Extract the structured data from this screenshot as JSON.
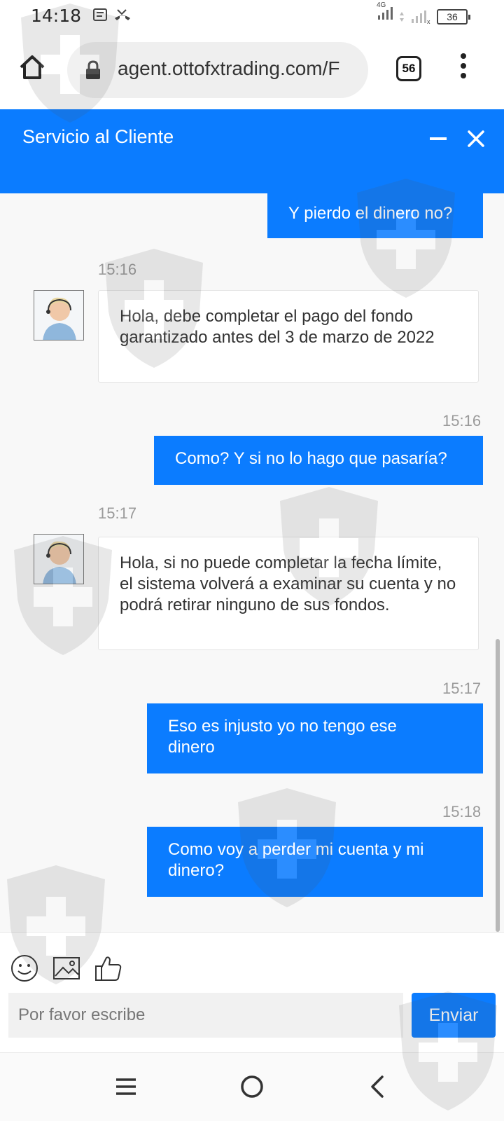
{
  "status_bar": {
    "time": "14:18",
    "network": "4G",
    "battery": "36"
  },
  "browser": {
    "url": "agent.ottofxtrading.com/F",
    "tab_count": "56"
  },
  "chat": {
    "title": "Servicio al Cliente",
    "messages": [
      {
        "sender": "user",
        "text": "Y pierdo el dinero no?"
      },
      {
        "sender": "agent",
        "time": "15:16",
        "text": "Hola, debe completar el pago del fondo garantizado antes del 3 de marzo de 2022"
      },
      {
        "sender": "user",
        "time": "15:16",
        "text": "Como? Y si no lo hago que pasaría?"
      },
      {
        "sender": "agent",
        "time": "15:17",
        "text": "Hola, si no puede completar la fecha límite, el sistema volverá a examinar su cuenta y no podrá retirar ninguno de sus fondos."
      },
      {
        "sender": "user",
        "time": "15:17",
        "text": "Eso es injusto yo no tengo ese dinero"
      },
      {
        "sender": "user",
        "time": "15:18",
        "text": "Como voy a perder mi cuenta y mi dinero?"
      }
    ]
  },
  "composer": {
    "placeholder": "Por favor escribe",
    "send_label": "Enviar"
  },
  "colors": {
    "accent": "#0b7cff",
    "chat_background": "#f8f8f8"
  },
  "icons": [
    "home-icon",
    "lock-icon",
    "tabs-icon",
    "menu-icon",
    "minimize-icon",
    "close-icon",
    "emoji-icon",
    "image-icon",
    "thumbs-up-icon",
    "recents-icon",
    "home-circle-icon",
    "back-icon"
  ]
}
